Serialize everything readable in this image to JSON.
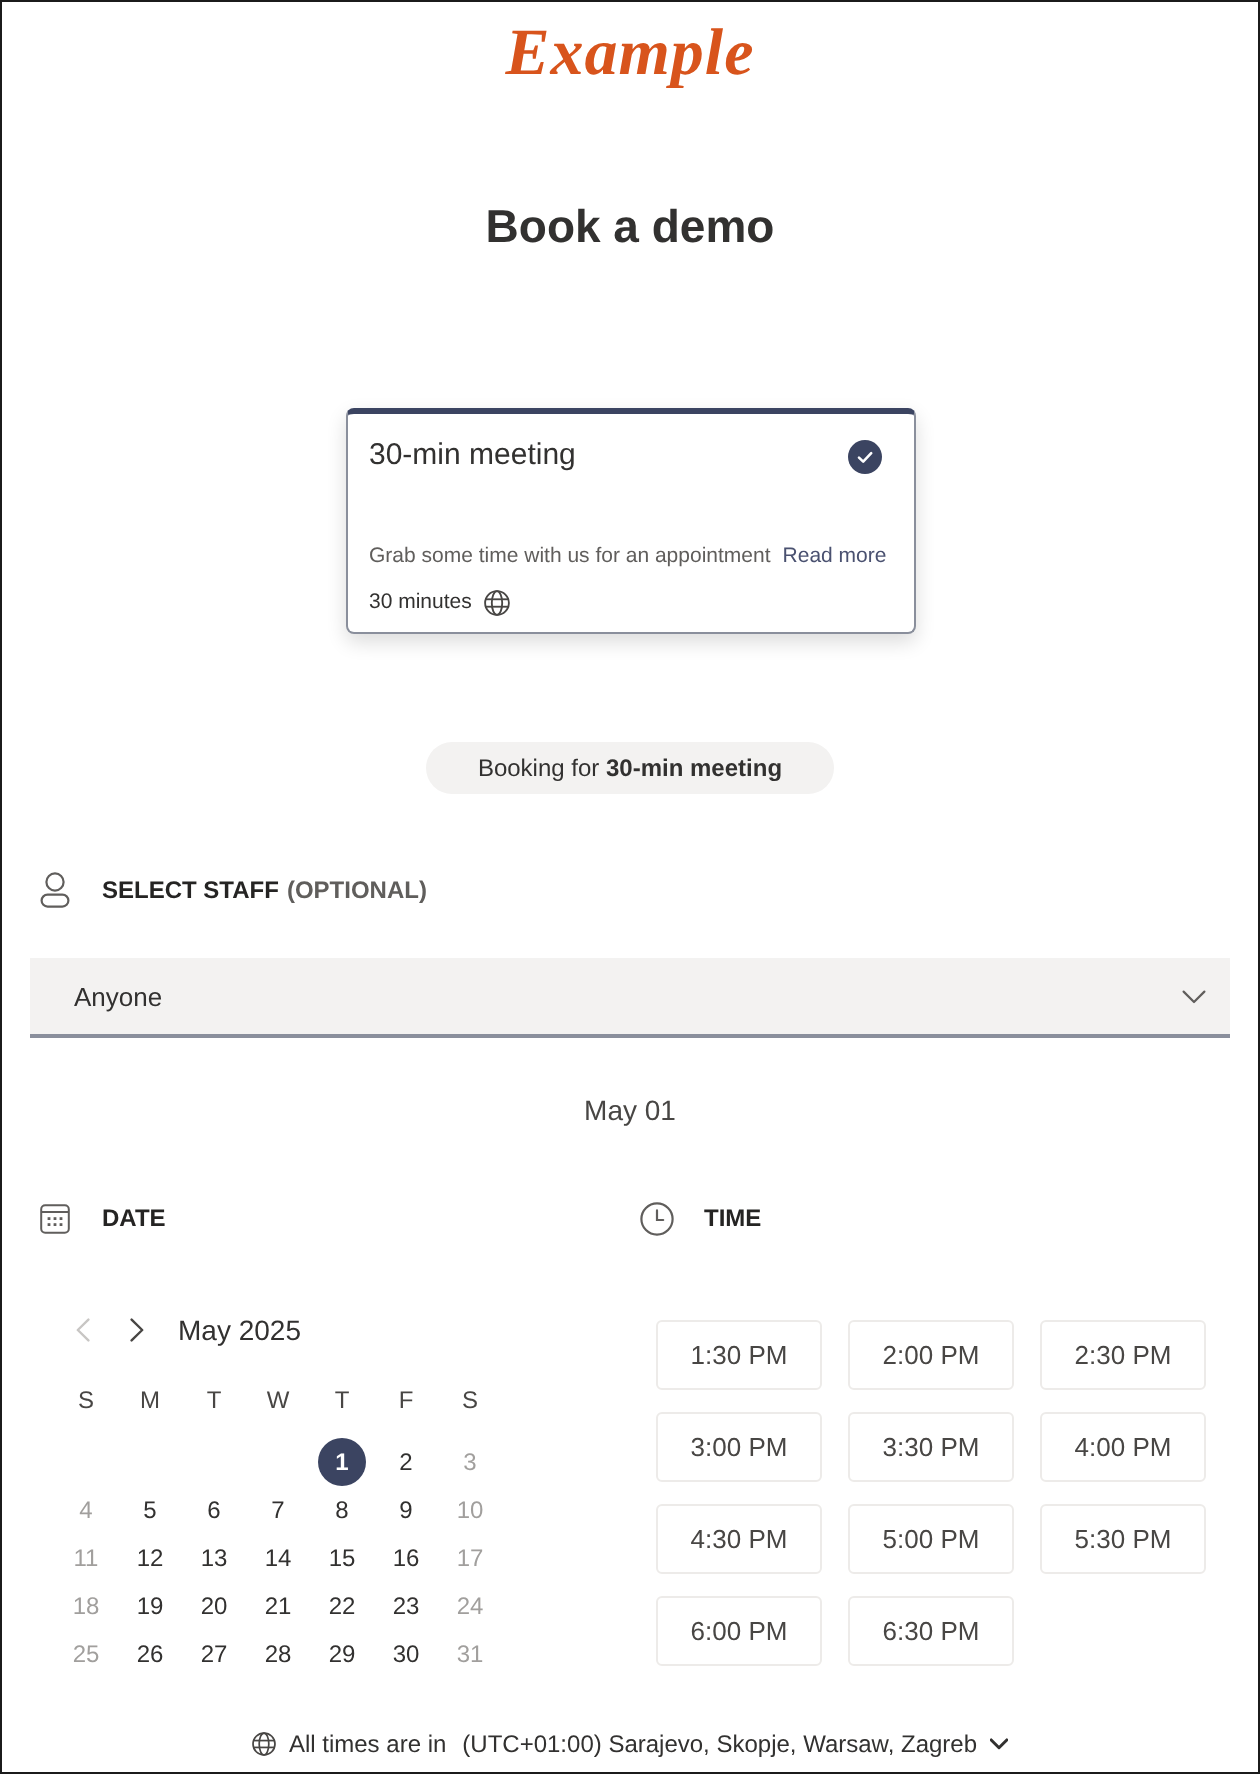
{
  "logo": {
    "text": "Example"
  },
  "title": "Book a demo",
  "service_card": {
    "name": "30-min meeting",
    "selected": true,
    "description": "Grab some time with us for an appointment",
    "link": "Read more",
    "duration": "30 minutes"
  },
  "booking_for": "Booking for **30-min meeting**",
  "staff": {
    "label": "SELECT STAFF",
    "hint": "(OPTIONAL)",
    "value": "Anyone"
  },
  "selected_date": "May 01",
  "date_section": {
    "heading": "DATE",
    "month": "May 2025",
    "prev_disabled": true,
    "next_disabled": false,
    "weekdays": [
      "S",
      "M",
      "T",
      "W",
      "T",
      "F",
      "S"
    ],
    "weeks": [
      [
        {
          "day": "1",
          "selected": true,
          "disabled": false
        },
        {
          "day": "2",
          "selected": false,
          "disabled": false
        },
        {
          "day": "3",
          "selected": false,
          "disabled": true
        }
      ],
      [
        {
          "day": "4",
          "selected": false,
          "disabled": true
        },
        {
          "day": "5",
          "selected": false,
          "disabled": false
        },
        {
          "day": "6",
          "selected": false,
          "disabled": false
        },
        {
          "day": "7",
          "selected": false,
          "disabled": false
        },
        {
          "day": "8",
          "selected": false,
          "disabled": false
        },
        {
          "day": "9",
          "selected": false,
          "disabled": false
        },
        {
          "day": "10",
          "selected": false,
          "disabled": true
        }
      ],
      [
        {
          "day": "11",
          "selected": false,
          "disabled": true
        },
        {
          "day": "12",
          "selected": false,
          "disabled": false
        },
        {
          "day": "13",
          "selected": false,
          "disabled": false
        },
        {
          "day": "14",
          "selected": false,
          "disabled": false
        },
        {
          "day": "15",
          "selected": false,
          "disabled": false
        },
        {
          "day": "16",
          "selected": false,
          "disabled": false
        },
        {
          "day": "17",
          "selected": false,
          "disabled": true
        }
      ],
      [
        {
          "day": "18",
          "selected": false,
          "disabled": true
        },
        {
          "day": "19",
          "selected": false,
          "disabled": false
        },
        {
          "day": "20",
          "selected": false,
          "disabled": false
        },
        {
          "day": "21",
          "selected": false,
          "disabled": false
        },
        {
          "day": "22",
          "selected": false,
          "disabled": false
        },
        {
          "day": "23",
          "selected": false,
          "disabled": false
        },
        {
          "day": "24",
          "selected": false,
          "disabled": true
        }
      ],
      [
        {
          "day": "25",
          "selected": false,
          "disabled": true
        },
        {
          "day": "26",
          "selected": false,
          "disabled": false
        },
        {
          "day": "27",
          "selected": false,
          "disabled": false
        },
        {
          "day": "28",
          "selected": false,
          "disabled": false
        },
        {
          "day": "29",
          "selected": false,
          "disabled": false
        },
        {
          "day": "30",
          "selected": false,
          "disabled": false
        },
        {
          "day": "31",
          "selected": false,
          "disabled": true
        }
      ]
    ]
  },
  "time_section": {
    "heading": "TIME",
    "slots": [
      {
        "time": "1:30 PM",
        "selected": false
      },
      {
        "time": "2:00 PM",
        "selected": false
      },
      {
        "time": "2:30 PM",
        "selected": false
      },
      {
        "time": "3:00 PM",
        "selected": false
      },
      {
        "time": "3:30 PM",
        "selected": false
      },
      {
        "time": "4:00 PM",
        "selected": false
      },
      {
        "time": "4:30 PM",
        "selected": false
      },
      {
        "time": "5:00 PM",
        "selected": false
      },
      {
        "time": "5:30 PM",
        "selected": false
      },
      {
        "time": "6:00 PM",
        "selected": false
      },
      {
        "time": "6:30 PM",
        "selected": false
      }
    ]
  },
  "timezone": {
    "label": "All times are in",
    "value": "(UTC+01:00) Sarajevo, Skopje, Warsaw, Zagreb"
  }
}
